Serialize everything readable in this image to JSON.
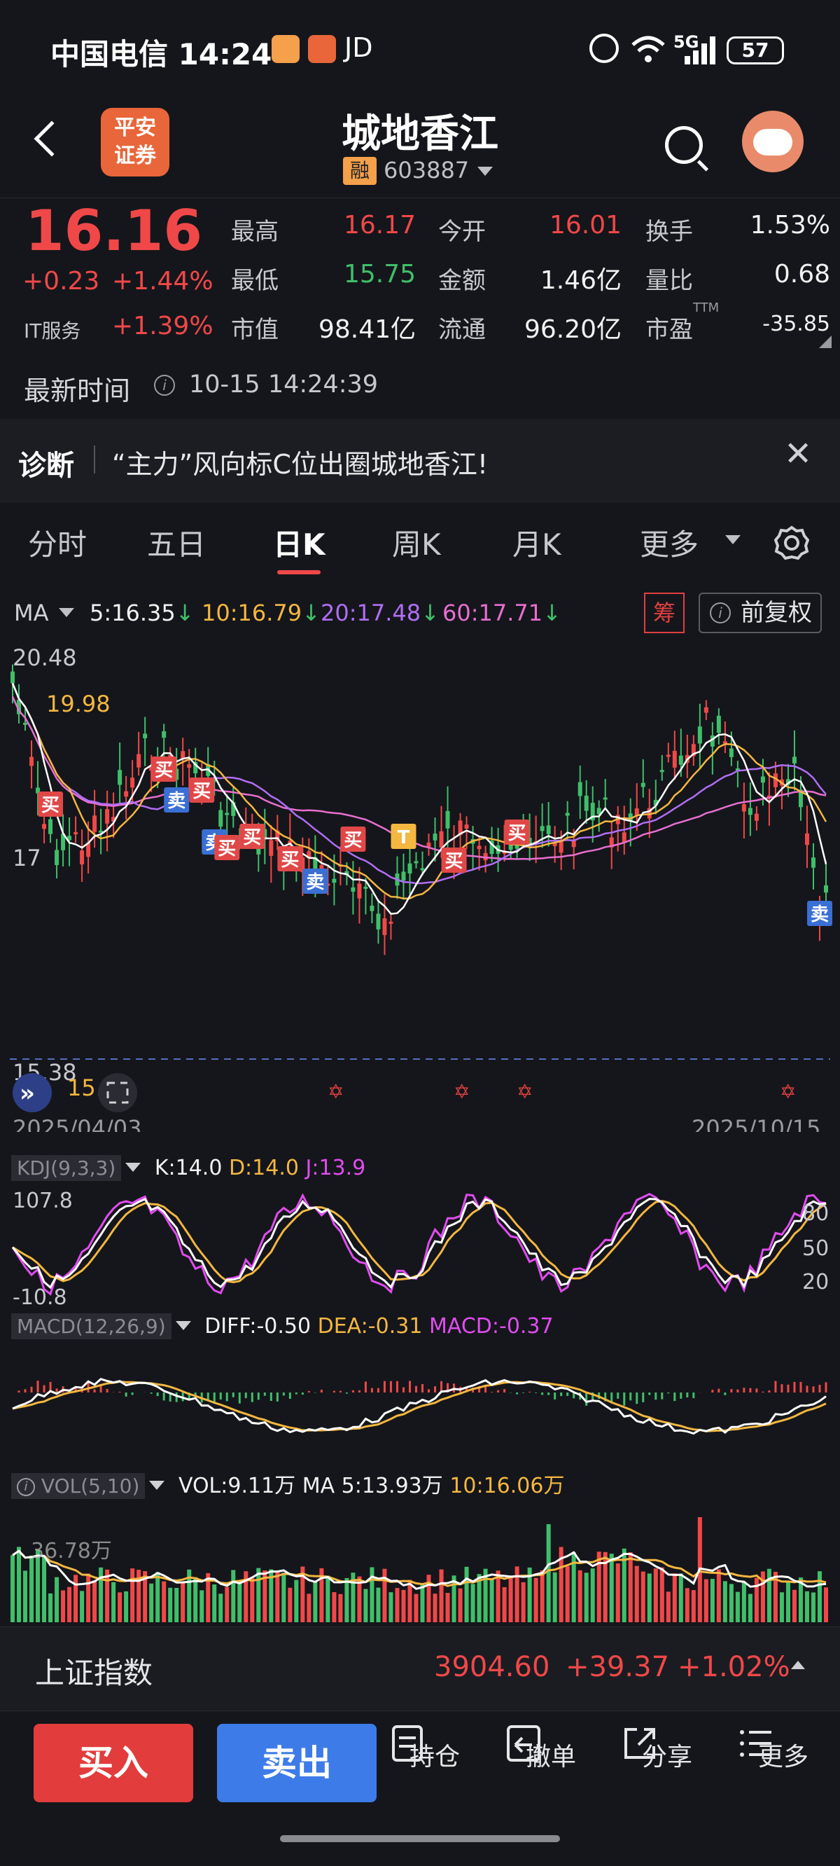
{
  "status_bar": {
    "carrier": "中国电信",
    "time": "14:24",
    "extra": "JD",
    "network": "5G",
    "battery": "57"
  },
  "header": {
    "back_icon": "chevron-left-icon",
    "broker_logo_text": "平安\n证券",
    "stock_name": "城地香江",
    "margin_tag": "融",
    "stock_code": "603887"
  },
  "quote": {
    "price": "16.16",
    "change": "+0.23",
    "change_pct": "+1.44%",
    "sector_name": "IT服务",
    "sector_pct": "+1.39%",
    "fields": {
      "high_label": "最高",
      "high": "16.17",
      "open_label": "今开",
      "open": "16.01",
      "turnover_label": "换手",
      "turnover": "1.53%",
      "low_label": "最低",
      "low": "15.75",
      "amount_label": "金额",
      "amount": "1.46亿",
      "volume_ratio_label": "量比",
      "volume_ratio": "0.68",
      "mktcap_label": "市值",
      "mktcap": "98.41亿",
      "float_label": "流通",
      "float": "96.20亿",
      "pe_label": "市盈",
      "pe_sup": "TTM",
      "pe": "-35.85"
    },
    "latest_time_label": "最新时间",
    "latest_time": "10-15 14:24:39"
  },
  "diagnosis": {
    "label": "诊断",
    "text": "“主力”风向标C位出圈城地香江!"
  },
  "tabs": [
    "分时",
    "五日",
    "日K",
    "周K",
    "月K",
    "更多"
  ],
  "active_tab": "日K",
  "ma_row": {
    "label": "MA",
    "ma5": "5:16.35",
    "ma10": "10:16.79",
    "ma20": "20:17.48",
    "ma60": "60:17.71",
    "chou": "筹",
    "fuquan": "前复权"
  },
  "kline": {
    "high_label": "20.48",
    "ma_start_label": "19.98",
    "low_label": "15.38",
    "low_ma_label": "15.38",
    "mid_label": "17",
    "start_date": "2025/04/03",
    "end_date": "2025/10/15",
    "markers": [
      "买",
      "买",
      "卖",
      "买",
      "卖",
      "买",
      "买",
      "买",
      "卖",
      "买",
      "T",
      "买",
      "买",
      "卖"
    ]
  },
  "kdj": {
    "label": "KDJ(9,3,3)",
    "k": "K:14.0",
    "d": "D:14.0",
    "j": "J:13.9",
    "max": "107.8",
    "min": "-10.8",
    "lv80": "80",
    "lv50": "50",
    "lv20": "20"
  },
  "macd": {
    "label": "MACD(12,26,9)",
    "diff": "DIFF:-0.50",
    "dea": "DEA:-0.31",
    "macd": "MACD:-0.37"
  },
  "vol": {
    "label": "VOL(5,10)",
    "vol": "VOL:9.11万",
    "ma5": "MA 5:13.93万",
    "ma10": "10:16.06万",
    "axis": "36.78万"
  },
  "index_bar": {
    "name": "上证指数",
    "value": "3904.60",
    "change": "+39.37",
    "change_pct": "+1.02%"
  },
  "bottom": {
    "buy": "买入",
    "sell": "卖出",
    "items": [
      "持仓",
      "撤单",
      "分享",
      "更多"
    ]
  },
  "colors": {
    "up": "#f04848",
    "down": "#3fbf6a",
    "ma10": "#f4b740",
    "ma20": "#b06ef5",
    "ma60": "#e86fd0",
    "buy_button": "#e23c3c",
    "sell_button": "#3d7be8"
  }
}
